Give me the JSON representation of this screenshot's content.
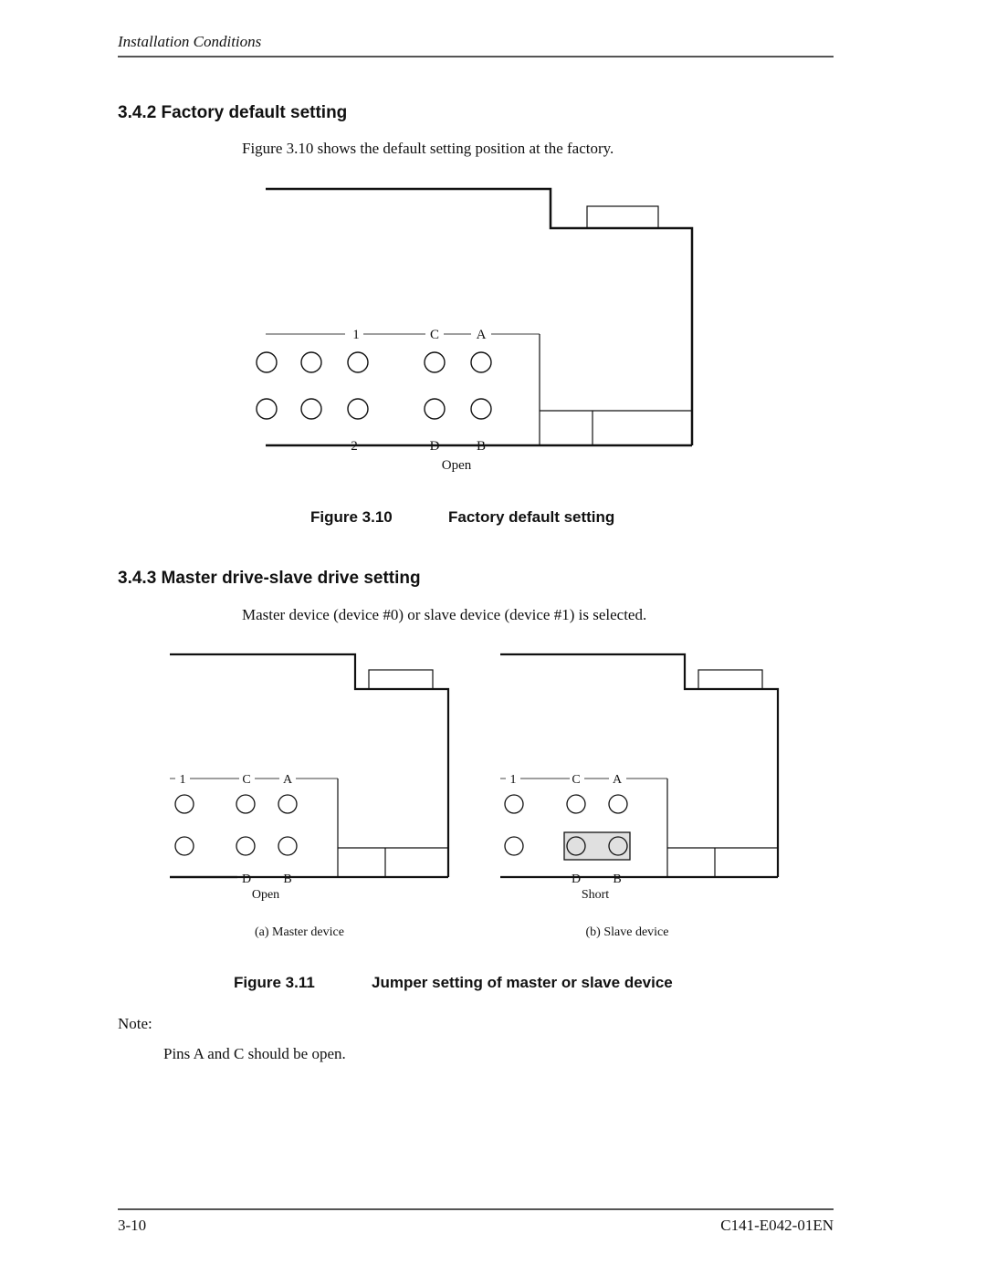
{
  "header": {
    "running_title": "Installation Conditions"
  },
  "sections": [
    {
      "number": "3.4.2",
      "title": "Factory default setting",
      "heading": "3.4.2  Factory default setting",
      "body": "Figure 3.10 shows the default setting position at the factory."
    },
    {
      "number": "3.4.3",
      "title": "Master drive-slave drive setting",
      "heading": "3.4.3  Master drive-slave drive setting",
      "body": "Master device (device #0) or slave device (device #1) is selected."
    }
  ],
  "figures": {
    "fig310": {
      "number": "Figure 3.10",
      "caption": "Factory default setting",
      "top_labels": [
        "1",
        "C",
        "A"
      ],
      "bottom_labels": [
        "2",
        "D",
        "B"
      ],
      "state_label": "Open",
      "pins_per_row": 5,
      "jumper": "none"
    },
    "fig311": {
      "number": "Figure 3.11",
      "caption": "Jumper setting of master or slave device",
      "panels": [
        {
          "id": "a",
          "subcaption": "(a)  Master device",
          "top_labels": [
            "1",
            "C",
            "A"
          ],
          "bottom_labels": [
            "D",
            "B"
          ],
          "state_label": "Open",
          "jumper": "none"
        },
        {
          "id": "b",
          "subcaption": "(b)  Slave device",
          "top_labels": [
            "1",
            "C",
            "A"
          ],
          "bottom_labels": [
            "D",
            "B"
          ],
          "state_label": "Short",
          "jumper": "D-B"
        }
      ]
    }
  },
  "note": {
    "label": "Note:",
    "text": "Pins A and C should be open."
  },
  "footer": {
    "page_number": "3-10",
    "doc_code": "C141-E042-01EN"
  },
  "colors": {
    "line": "#111111",
    "jumper_fill": "#e0e0e0",
    "rule": "#555555"
  }
}
